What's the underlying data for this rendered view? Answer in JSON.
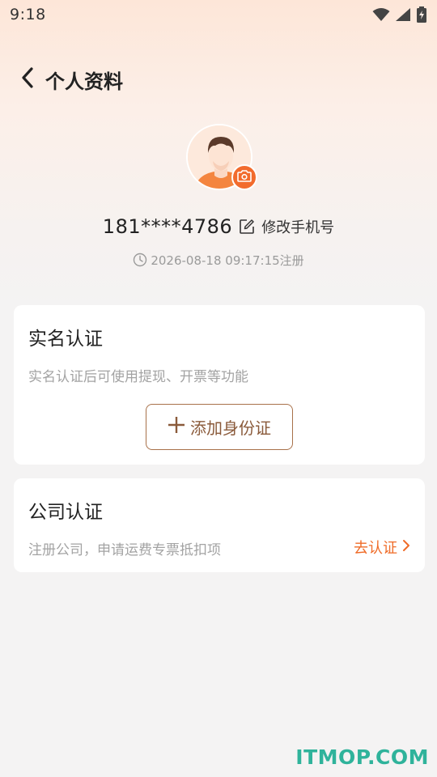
{
  "status_bar": {
    "time": "9:18",
    "icons": [
      "wifi-icon",
      "cellular-signal-icon",
      "battery-charging-icon"
    ]
  },
  "header": {
    "back_icon": "chevron-left-icon",
    "title": "个人资料"
  },
  "profile": {
    "avatar_icon": "user-avatar",
    "camera_icon": "camera-icon",
    "phone": "181****4786",
    "edit_icon": "edit-icon",
    "edit_phone_label": "修改手机号",
    "clock_icon": "clock-icon",
    "registered": "2026-08-18 09:17:15注册"
  },
  "realname_card": {
    "title": "实名认证",
    "description": "实名认证后可使用提现、开票等功能",
    "button_label": "添加身份证",
    "button_icon": "plus-icon"
  },
  "company_card": {
    "title": "公司认证",
    "description": "注册公司，申请运费专票抵扣项",
    "action_label": "去认证",
    "action_icon": "chevron-right-icon"
  },
  "watermark": "ITMOP.COM",
  "colors": {
    "accent": "#ef6b27",
    "button_border": "#a8714a",
    "muted_text": "#a3a3a3",
    "watermark": "#2fb39b"
  }
}
